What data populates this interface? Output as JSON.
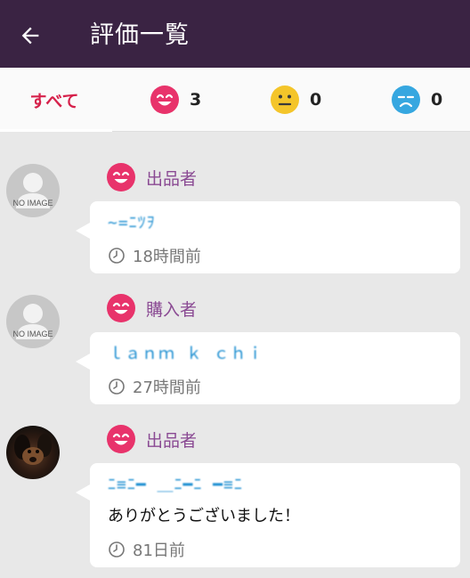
{
  "appbar": {
    "title": "評価一覧",
    "back_icon": "arrow-left-icon"
  },
  "tabs": {
    "all_label": "すべて",
    "counts": [
      {
        "type": "good",
        "icon": "smile-face-icon",
        "color": "#e8336b",
        "count": "3"
      },
      {
        "type": "normal",
        "icon": "neutral-face-icon",
        "color": "#f4c52a",
        "count": "0"
      },
      {
        "type": "bad",
        "icon": "sad-face-icon",
        "color": "#36a7e0",
        "count": "0"
      }
    ]
  },
  "avatar_placeholder": "NO IMAGE",
  "reviews": [
    {
      "role": "出品者",
      "rating": "good",
      "username": "~=ﾆﾂｦ",
      "comment": "",
      "time": "18時間前"
    },
    {
      "role": "購入者",
      "rating": "good",
      "username": "ｌａｎｍ ｋ ｃｈｉ",
      "comment": "",
      "time": "27時間前"
    },
    {
      "role": "出品者",
      "rating": "good",
      "username": "ﾆ≡ﾆ━  ＿ﾆ━ﾆ   ━≡ﾆ",
      "comment": "ありがとうございました！",
      "time": "81日前"
    }
  ],
  "colors": {
    "appbar": "#3a2343",
    "accent": "#d6214b",
    "role": "#8a4a93",
    "username": "#1e8fd1"
  }
}
